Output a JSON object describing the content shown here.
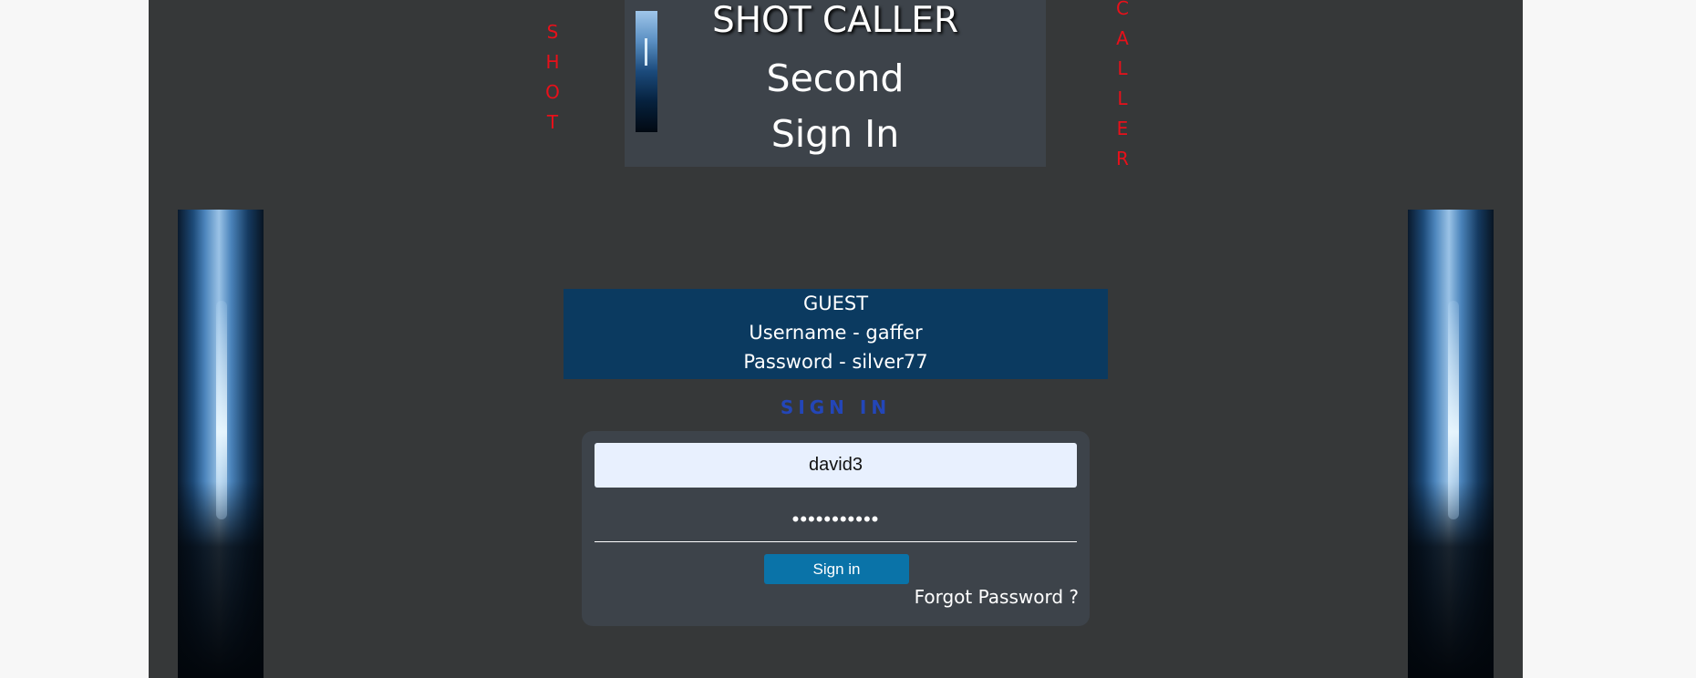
{
  "brand": {
    "vertical_left": [
      "S",
      "H",
      "O",
      "T"
    ],
    "vertical_right": [
      "C",
      "A",
      "L",
      "L",
      "E",
      "R"
    ],
    "accent_color": "#e8101a"
  },
  "header": {
    "title": "SHOT CALLER",
    "subtitle": "Second",
    "page_title": "Sign In"
  },
  "guest": {
    "heading": "GUEST",
    "username_line": "Username - gaffer",
    "password_line": "Password - silver77"
  },
  "form": {
    "heading": "SIGN IN",
    "username_value": "david3",
    "password_value": "•••••••••••",
    "submit_label": "Sign in",
    "forgot_label": "Forgot Password ?"
  },
  "colors": {
    "page_bg": "#363839",
    "panel_bg": "#3d434a",
    "guest_bg": "#0b3a60",
    "button_bg": "#0a73a8",
    "heading_blue": "#2346b8"
  }
}
